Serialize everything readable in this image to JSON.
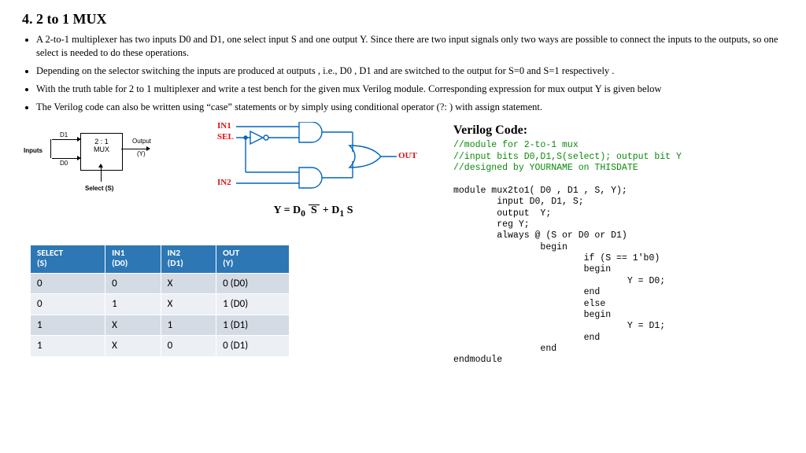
{
  "title": "4. 2 to 1 MUX",
  "bullets": [
    "A 2-to-1 multiplexer has two inputs D0 and D1, one select input S and one output Y. Since there are two input signals only two ways are possible to connect the inputs to the outputs, so one select is needed to do these operations.",
    "Depending on the selector switching the inputs are produced at outputs , i.e., D0 , D1 and are switched to the output for S=0 and S=1 respectively .",
    "With the truth table for 2 to 1 multiplexer and write a  test bench for the given mux Verilog module. Corresponding expression for mux output Y is given below",
    "The Verilog code can also be written using “case” statements or by simply using conditional operator (?: ) with assign statement."
  ],
  "block_diagram": {
    "inputs_label": "Inputs",
    "d1": "D1",
    "d0": "D0",
    "box_top": "2 : 1",
    "box_bot": "MUX",
    "out_top": "Output",
    "out_bot": "(Y)",
    "select": "Select (S)"
  },
  "gate_diagram": {
    "in1": "IN1",
    "sel": "SEL",
    "in2": "IN2",
    "out": "OUT"
  },
  "equation": {
    "pre": "Y = D",
    "sub0": "0",
    "sbar": "S̅",
    "mid": " + D",
    "sub1": "1",
    "post": " S"
  },
  "truth": {
    "headers": [
      {
        "l1": "SELECT",
        "l2": "(S)"
      },
      {
        "l1": "IN1",
        "l2": "(D0)"
      },
      {
        "l1": "IN2",
        "l2": "(D1)"
      },
      {
        "l1": "OUT",
        "l2": "(Y)"
      }
    ],
    "rows": [
      [
        "0",
        "0",
        "X",
        "0 (D0)"
      ],
      [
        "0",
        "1",
        "X",
        "1 (D0)"
      ],
      [
        "1",
        "X",
        "1",
        "1 (D1)"
      ],
      [
        "1",
        "X",
        "0",
        "0 (D1)"
      ]
    ]
  },
  "code": {
    "title": "Verilog Code:",
    "lines": [
      {
        "t": "//module for 2-to-1 mux",
        "c": true
      },
      {
        "t": "//input bits D0,D1,S(select); output bit Y",
        "c": true
      },
      {
        "t": "//designed by YOURNAME on THISDATE",
        "c": true
      },
      {
        "t": "",
        "c": false
      },
      {
        "t": "module mux2to1( D0 , D1 , S, Y);",
        "c": false
      },
      {
        "t": "        input D0, D1, S;",
        "c": false
      },
      {
        "t": "        output  Y;",
        "c": false
      },
      {
        "t": "        reg Y;",
        "c": false
      },
      {
        "t": "        always @ (S or D0 or D1)",
        "c": false
      },
      {
        "t": "                begin",
        "c": false
      },
      {
        "t": "                        if (S == 1'b0)",
        "c": false
      },
      {
        "t": "                        begin",
        "c": false
      },
      {
        "t": "                                Y = D0;",
        "c": false
      },
      {
        "t": "                        end",
        "c": false
      },
      {
        "t": "                        else",
        "c": false
      },
      {
        "t": "                        begin",
        "c": false
      },
      {
        "t": "                                Y = D1;",
        "c": false
      },
      {
        "t": "                        end",
        "c": false
      },
      {
        "t": "                end",
        "c": false
      },
      {
        "t": "endmodule",
        "c": false
      }
    ]
  }
}
